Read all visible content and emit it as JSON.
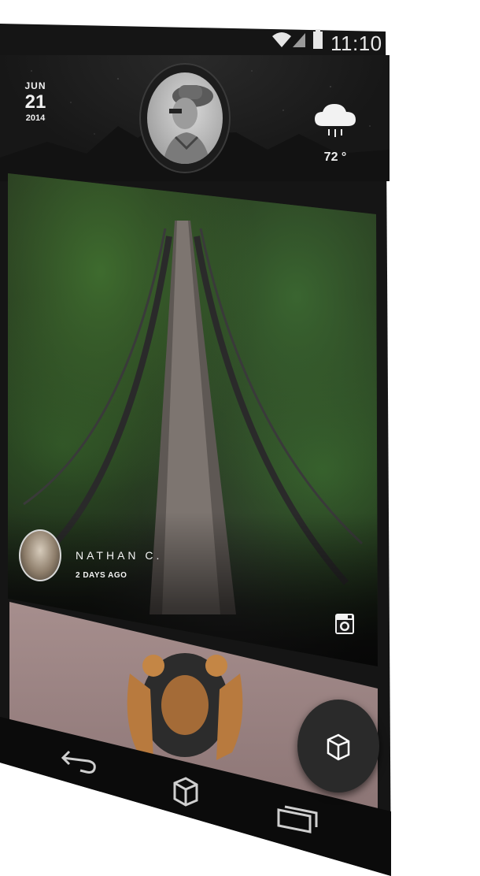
{
  "status_bar": {
    "time": "11:10",
    "icons": [
      "wifi-icon",
      "signal-icon",
      "battery-icon"
    ]
  },
  "header": {
    "date": {
      "month": "JUN",
      "day": "21",
      "year": "2014"
    },
    "weather": {
      "icon": "cloud-rain-icon",
      "temperature": "72 °"
    }
  },
  "feed": {
    "posts": [
      {
        "author": "NATHAN C.",
        "time_ago": "2 DAYS AGO",
        "source_icon": "instagram-icon"
      }
    ]
  },
  "fab": {
    "icon": "cube-icon"
  },
  "navigation": {
    "buttons": [
      "back-icon",
      "home-cube-icon",
      "recent-apps-icon"
    ]
  }
}
